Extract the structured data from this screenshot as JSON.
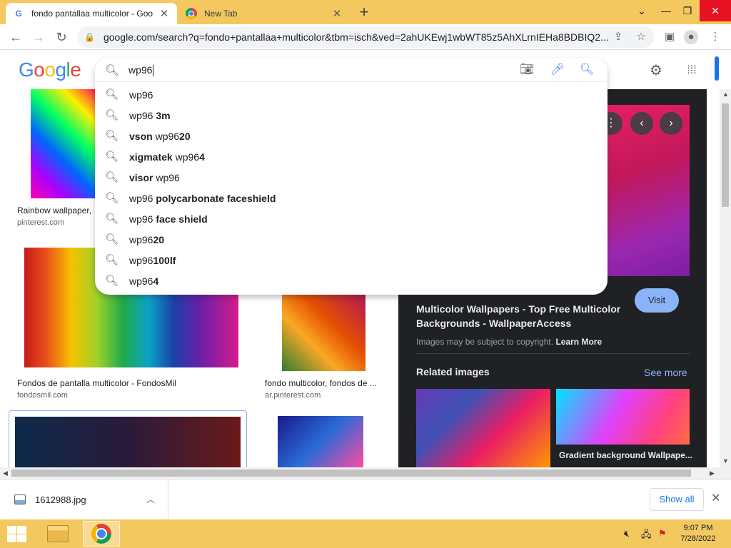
{
  "browser": {
    "tabs": [
      {
        "title": "fondo pantallaa multicolor - Goo",
        "active": true,
        "icon": "google-g-icon"
      },
      {
        "title": "New Tab",
        "active": false,
        "icon": "chrome-icon"
      }
    ],
    "url": "google.com/search?q=fondo+pantallaa+multicolor&tbm=isch&ved=2ahUKEwj1wbWT85z5AhXLrnIEHa8BDBIQ2..."
  },
  "header": {
    "logo_letters": [
      "G",
      "o",
      "o",
      "g",
      "l",
      "e"
    ]
  },
  "search": {
    "query": "wp96",
    "suggestions": [
      {
        "prefix": "wp96",
        "bold": "",
        "suffix": ""
      },
      {
        "prefix": "wp96 ",
        "bold": "3m",
        "suffix": ""
      },
      {
        "prefix": "",
        "bold": "vson",
        "suffix": " wp96",
        "bold2": "20"
      },
      {
        "prefix": "",
        "bold": "xigmatek",
        "suffix": " wp96",
        "bold2": "4"
      },
      {
        "prefix": "",
        "bold": "visor",
        "suffix": " wp96",
        "bold2": ""
      },
      {
        "prefix": "wp96 ",
        "bold": "polycarbonate faceshield",
        "suffix": ""
      },
      {
        "prefix": "wp96 ",
        "bold": "face shield",
        "suffix": ""
      },
      {
        "prefix": "wp96",
        "bold": "20",
        "suffix": ""
      },
      {
        "prefix": "wp96",
        "bold": "100lf",
        "suffix": ""
      },
      {
        "prefix": "wp96",
        "bold": "4",
        "suffix": ""
      }
    ]
  },
  "results": [
    {
      "caption": "Rainbow wallpaper,",
      "source": "pinterest.com"
    },
    {
      "caption": "Fondos de pantalla multicolor - FondosMil",
      "source": "fondosmil.com"
    },
    {
      "caption": "fondo multicolor, fondos de ...",
      "source": "ar.pinterest.com"
    }
  ],
  "panel": {
    "title": "Multicolor Wallpapers - Top Free Multicolor Backgrounds - WallpaperAccess",
    "visit_label": "Visit",
    "copyright": "Images may be subject to copyright.",
    "learn_more": "Learn More",
    "related_heading": "Related images",
    "see_more": "See more",
    "related_caption": "Gradient background Wallpape..."
  },
  "downloads": {
    "filename": "1612988.jpg",
    "show_all": "Show all"
  },
  "taskbar": {
    "time": "9:07 PM",
    "date": "7/28/2022"
  },
  "colors": {
    "accent": "#1a73e8",
    "tabstrip": "#f3c85f",
    "panel_bg": "#202124"
  }
}
